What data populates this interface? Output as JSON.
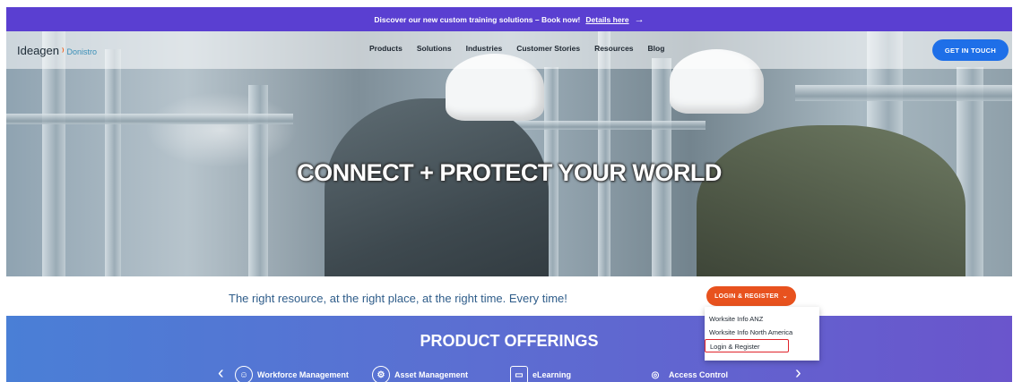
{
  "promo": {
    "text": "Discover our new custom training solutions – Book now!",
    "link": "Details here",
    "arrow": "→"
  },
  "header": {
    "logo_main": "Ideagen",
    "logo_mark": "⁾",
    "logo_sub": "Donistro",
    "nav": [
      "Products",
      "Solutions",
      "Industries",
      "Customer Stories",
      "Resources",
      "Blog"
    ],
    "cta": "GET IN TOUCH"
  },
  "hero": {
    "title": "CONNECT + PROTECT YOUR WORLD"
  },
  "tagline": {
    "text": "The right resource, at the right place, at the right time. Every time!",
    "login_label": "LOGIN & REGISTER",
    "login_caret": "⌄"
  },
  "dropdown": {
    "items": [
      "Worksite Info ANZ",
      "Worksite Info North America",
      "Login & Register"
    ]
  },
  "offerings": {
    "title": "PRODUCT OFFERINGS",
    "prev": "‹",
    "next": "›",
    "items": [
      {
        "label": "Workforce Management",
        "icon": "people-icon"
      },
      {
        "label": "Asset Management",
        "icon": "gear-icon"
      },
      {
        "label": "eLearning",
        "icon": "laptop-icon"
      },
      {
        "label": "Access Control",
        "icon": "fingerprint-icon"
      }
    ]
  },
  "colors": {
    "promo_bg": "#5a3fd1",
    "cta_bg": "#1e6fe8",
    "login_bg": "#e8521e",
    "highlight_border": "#e0242b"
  }
}
